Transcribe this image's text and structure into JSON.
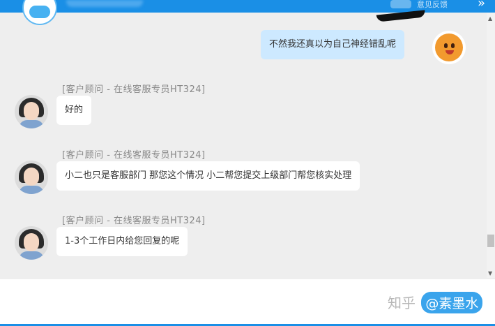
{
  "header": {
    "feedback_label": "意见反馈",
    "collapse_icon": "double-chevron-right-icon"
  },
  "messages": [
    {
      "from": "user",
      "text": "不然我还真以为自己神经错乱呢"
    },
    {
      "from": "agent",
      "sender": "[客户顾问 - 在线客服专员HT324]",
      "text": "好的"
    },
    {
      "from": "agent",
      "sender": "[客户顾问 - 在线客服专员HT324]",
      "text": "小二也只是客服部门 那您这个情况 小二帮您提交上级部门帮您核实处理"
    },
    {
      "from": "agent",
      "sender": "[客户顾问 - 在线客服专员HT324]",
      "text": "1-3个工作日内给您回复的呢"
    }
  ],
  "watermark": {
    "site": "知乎",
    "author": "@素墨水"
  },
  "colors": {
    "header_blue": "#1a8fe6",
    "user_bubble": "#cde9ff",
    "agent_bubble": "#ffffff",
    "chat_bg": "#eeeeee"
  }
}
